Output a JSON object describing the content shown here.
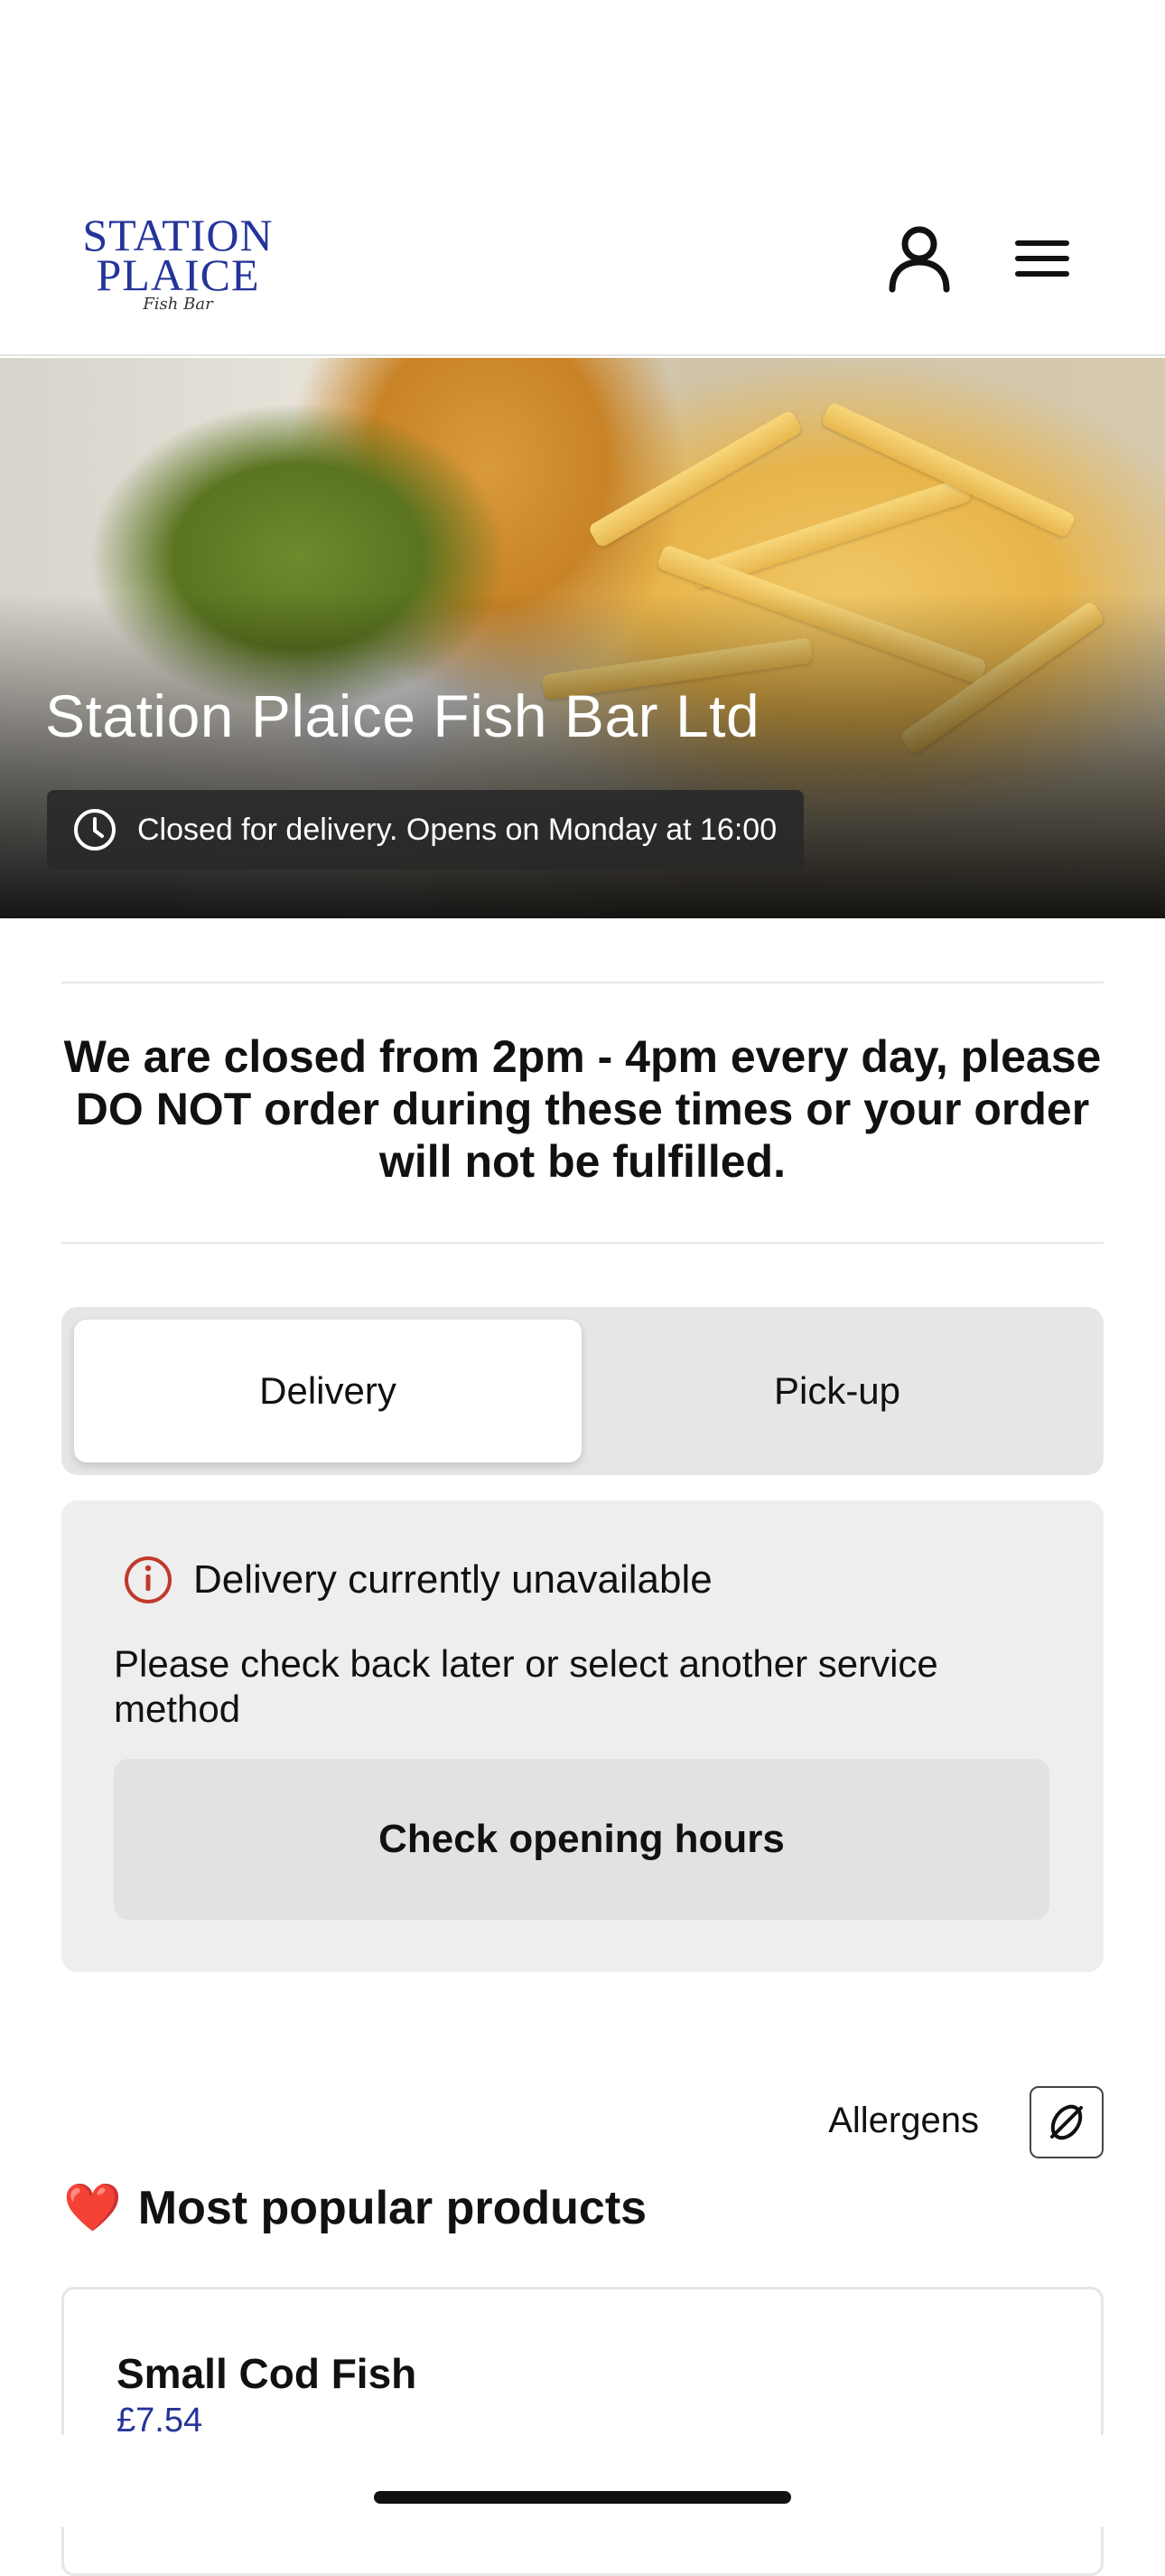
{
  "header": {
    "logo": {
      "line1": "STATION",
      "line2": "PLAICE",
      "script": "Fish Bar"
    },
    "account_icon": "person-icon",
    "menu_icon": "hamburger-menu-icon"
  },
  "hero": {
    "title": "Station Plaice Fish Bar Ltd",
    "status_icon": "clock-icon",
    "status_text": "Closed for delivery. Opens on Monday at 16:00"
  },
  "notice": {
    "text": "We are closed from 2pm - 4pm every day, please DO NOT order during these times or your order will not be fulfilled."
  },
  "service_toggle": {
    "selected": "Delivery",
    "delivery_label": "Delivery",
    "pickup_label": "Pick-up"
  },
  "unavailable": {
    "icon": "info-alert-icon",
    "accent_color": "#c0392b",
    "title": "Delivery currently unavailable",
    "body": "Please check back later or select another service method",
    "button_label": "Check opening hours"
  },
  "allergens": {
    "label": "Allergens",
    "icon": "no-allergen-icon"
  },
  "popular": {
    "emoji": "❤️",
    "heading": "Most popular products",
    "products": [
      {
        "name": "Small Cod Fish",
        "price": "£7.54"
      }
    ]
  },
  "colors": {
    "brand": "#24349a",
    "alert": "#c0392b"
  }
}
